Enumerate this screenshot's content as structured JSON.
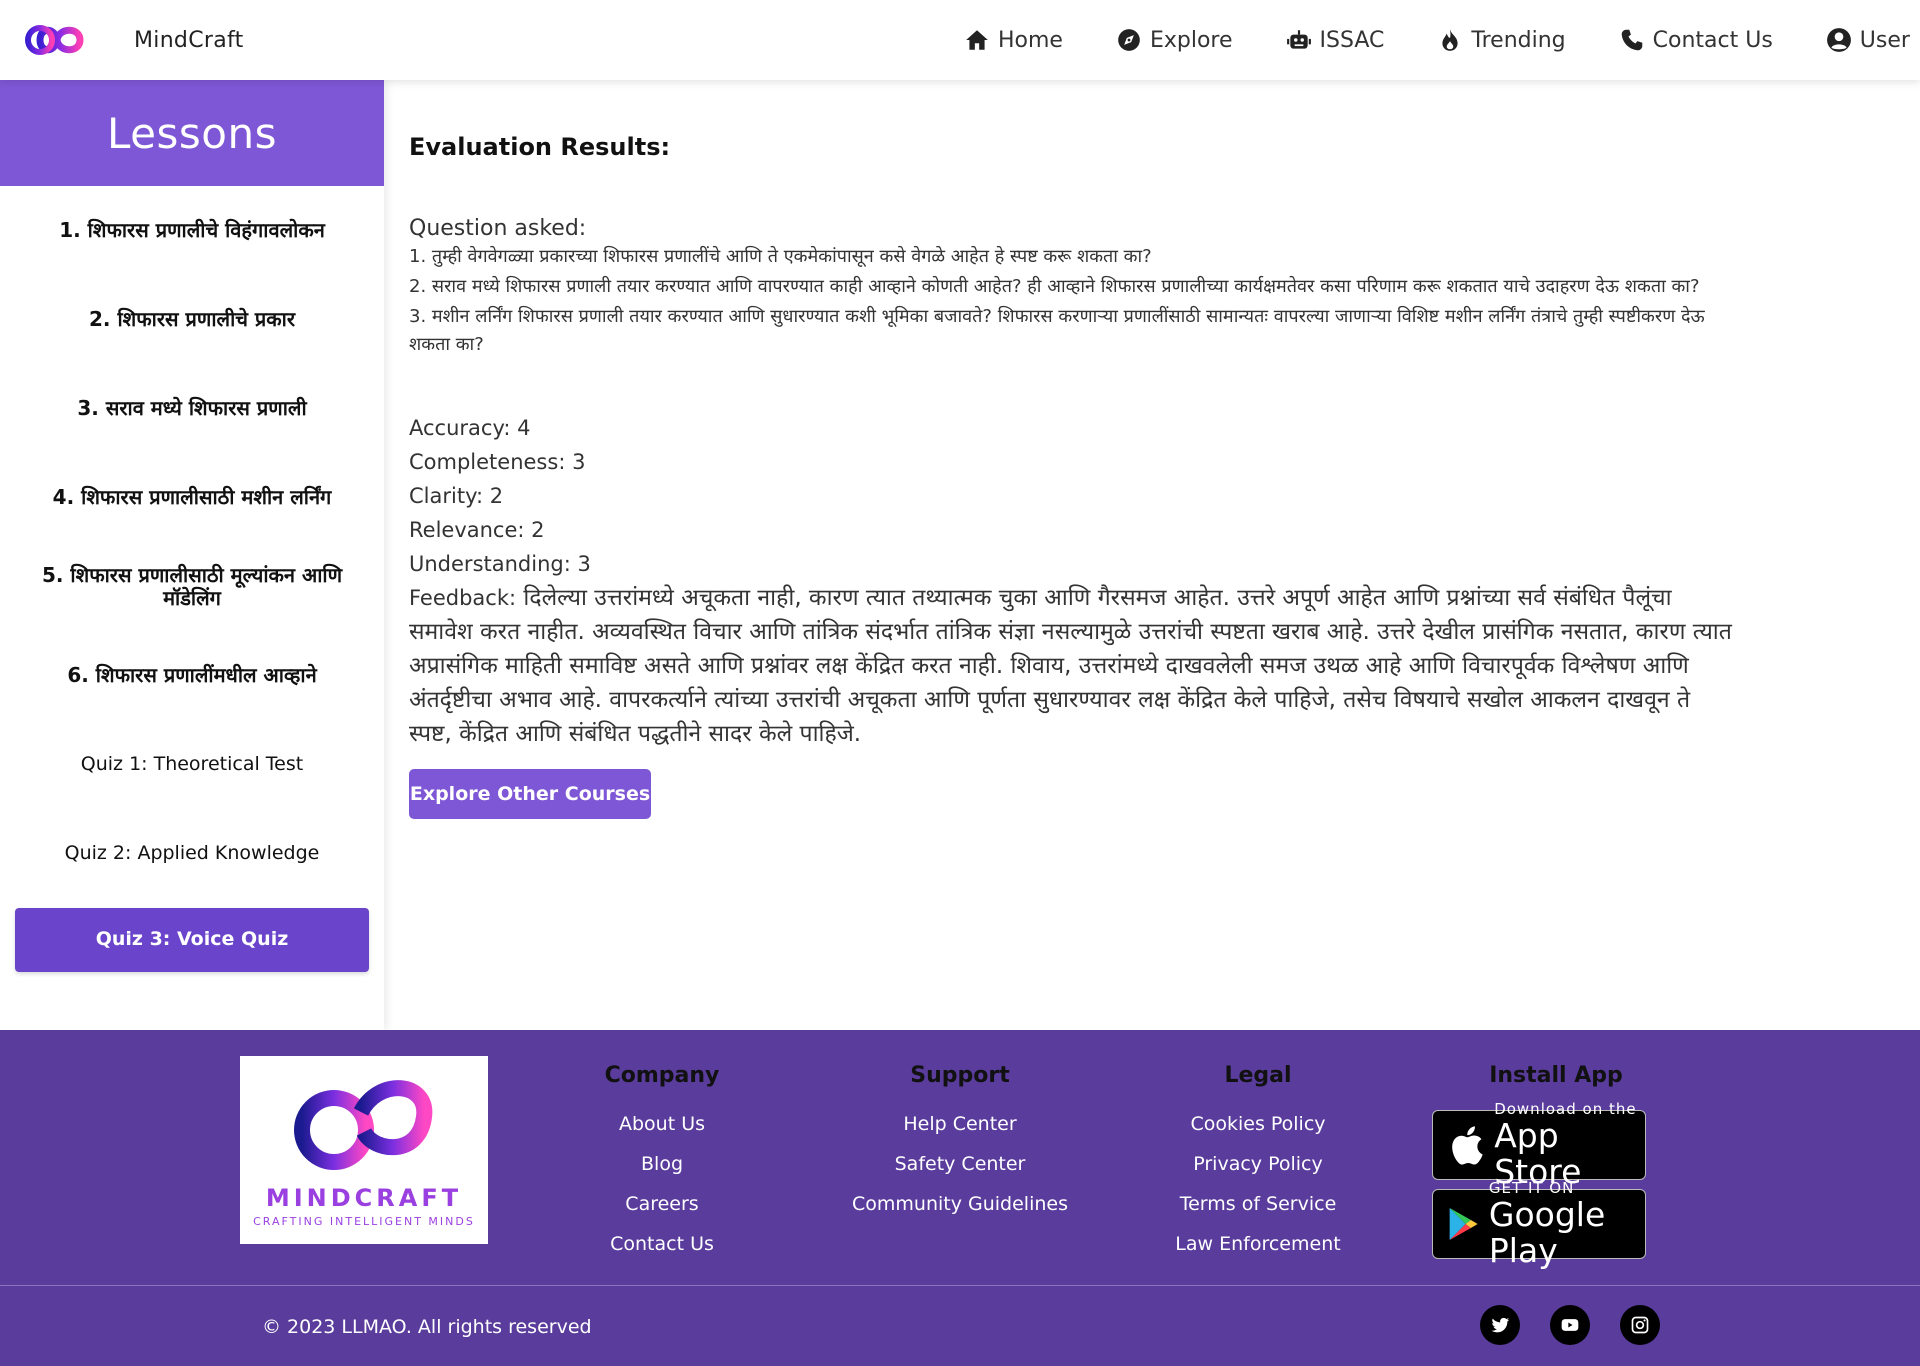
{
  "app": {
    "brand_name": "MindCraft"
  },
  "nav": {
    "items": [
      {
        "label": "Home",
        "icon": "home-icon"
      },
      {
        "label": "Explore",
        "icon": "compass-icon"
      },
      {
        "label": "ISSAC",
        "icon": "robot-icon"
      },
      {
        "label": "Trending",
        "icon": "fire-icon"
      },
      {
        "label": "Contact Us",
        "icon": "phone-icon"
      },
      {
        "label": "User",
        "icon": "user-circle-icon"
      }
    ]
  },
  "sidebar": {
    "title": "Lessons",
    "items": [
      "1. शिफारस प्रणालीचे विहंगावलोकन",
      "2. शिफारस प्रणालीचे प्रकार",
      "3. सराव मध्ये शिफारस प्रणाली",
      "4. शिफारस प्रणालीसाठी मशीन लर्निंग",
      "5. शिफारस प्रणालीसाठी मूल्यांकन आणि मॉडेलिंग",
      "6. शिफारस प्रणालींमधील आव्हाने"
    ],
    "quizzes": [
      "Quiz 1: Theoretical Test",
      "Quiz 2: Applied Knowledge",
      "Quiz 3: Voice Quiz"
    ],
    "active_item": "Quiz 3: Voice Quiz"
  },
  "main": {
    "title": "Evaluation Results:",
    "question_heading": "Question asked:",
    "questions": [
      "1. तुम्ही वेगवेगळ्या प्रकारच्या शिफारस प्रणालींचे आणि ते एकमेकांपासून कसे वेगळे आहेत हे स्पष्ट करू शकता का?",
      "2. सराव मध्ये शिफारस प्रणाली तयार करण्यात आणि वापरण्यात काही आव्हाने कोणती आहेत? ही आव्हाने शिफारस प्रणालीच्या कार्यक्षमतेवर कसा परिणाम करू शकतात याचे उदाहरण देऊ शकता का?",
      "3. मशीन लर्निंग शिफारस प्रणाली तयार करण्यात आणि सुधारण्यात कशी भूमिका बजावते? शिफारस करणाऱ्या प्रणालींसाठी सामान्यतः वापरल्या जाणाऱ्या विशिष्ट मशीन लर्निंग तंत्राचे तुम्ही स्पष्टीकरण देऊ शकता का?"
    ],
    "scores": [
      "Accuracy: 4",
      "Completeness: 3",
      "Clarity: 2",
      "Relevance: 2",
      "Understanding: 3"
    ],
    "feedback_label": "Feedback:",
    "feedback_text": "दिलेल्या उत्तरांमध्ये अचूकता नाही, कारण त्यात तथ्यात्मक चुका आणि गैरसमज आहेत. उत्तरे अपूर्ण आहेत आणि प्रश्नांच्या सर्व संबंधित पैलूंचा समावेश करत नाहीत. अव्यवस्थित विचार आणि तांत्रिक संदर्भात तांत्रिक संज्ञा नसल्यामुळे उत्तरांची स्पष्टता खराब आहे. उत्तरे देखील प्रासंगिक नसतात, कारण त्यात अप्रासंगिक माहिती समाविष्ट असते आणि प्रश्नांवर लक्ष केंद्रित करत नाही. शिवाय, उत्तरांमध्ये दाखवलेली समज उथळ आहे आणि विचारपूर्वक विश्लेषण आणि अंतर्दृष्टीचा अभाव आहे. वापरकर्त्याने त्यांच्या उत्तरांची अचूकता आणि पूर्णता सुधारण्यावर लक्ष केंद्रित केले पाहिजे, तसेच विषयाचे सखोल आकलन दाखवून ते स्पष्ट, केंद्रित आणि संबंधित पद्धतीने सादर केले पाहिजे.",
    "explore_button": "Explore Other Courses"
  },
  "footer": {
    "logo_name": "MINDCRAFT",
    "logo_tagline": "CRAFTING INTELLIGENT MINDS",
    "columns": [
      {
        "heading": "Company",
        "links": [
          "About Us",
          "Blog",
          "Careers",
          "Contact Us"
        ]
      },
      {
        "heading": "Support",
        "links": [
          "Help Center",
          "Safety Center",
          "Community Guidelines"
        ]
      },
      {
        "heading": "Legal",
        "links": [
          "Cookies Policy",
          "Privacy Policy",
          "Terms of Service",
          "Law Enforcement"
        ]
      }
    ],
    "install": {
      "heading": "Install App",
      "app_store_small": "Download on the",
      "app_store_big": "App Store",
      "google_play_small": "GET IT ON",
      "google_play_big": "Google Play"
    },
    "copyright": "© 2023 LLMAO. All rights reserved",
    "social": [
      "twitter-icon",
      "youtube-icon",
      "instagram-icon"
    ]
  },
  "colors": {
    "accent": "#7e57d6",
    "active_button": "#6a44cb",
    "footer_bg": "#5a3c9c"
  }
}
